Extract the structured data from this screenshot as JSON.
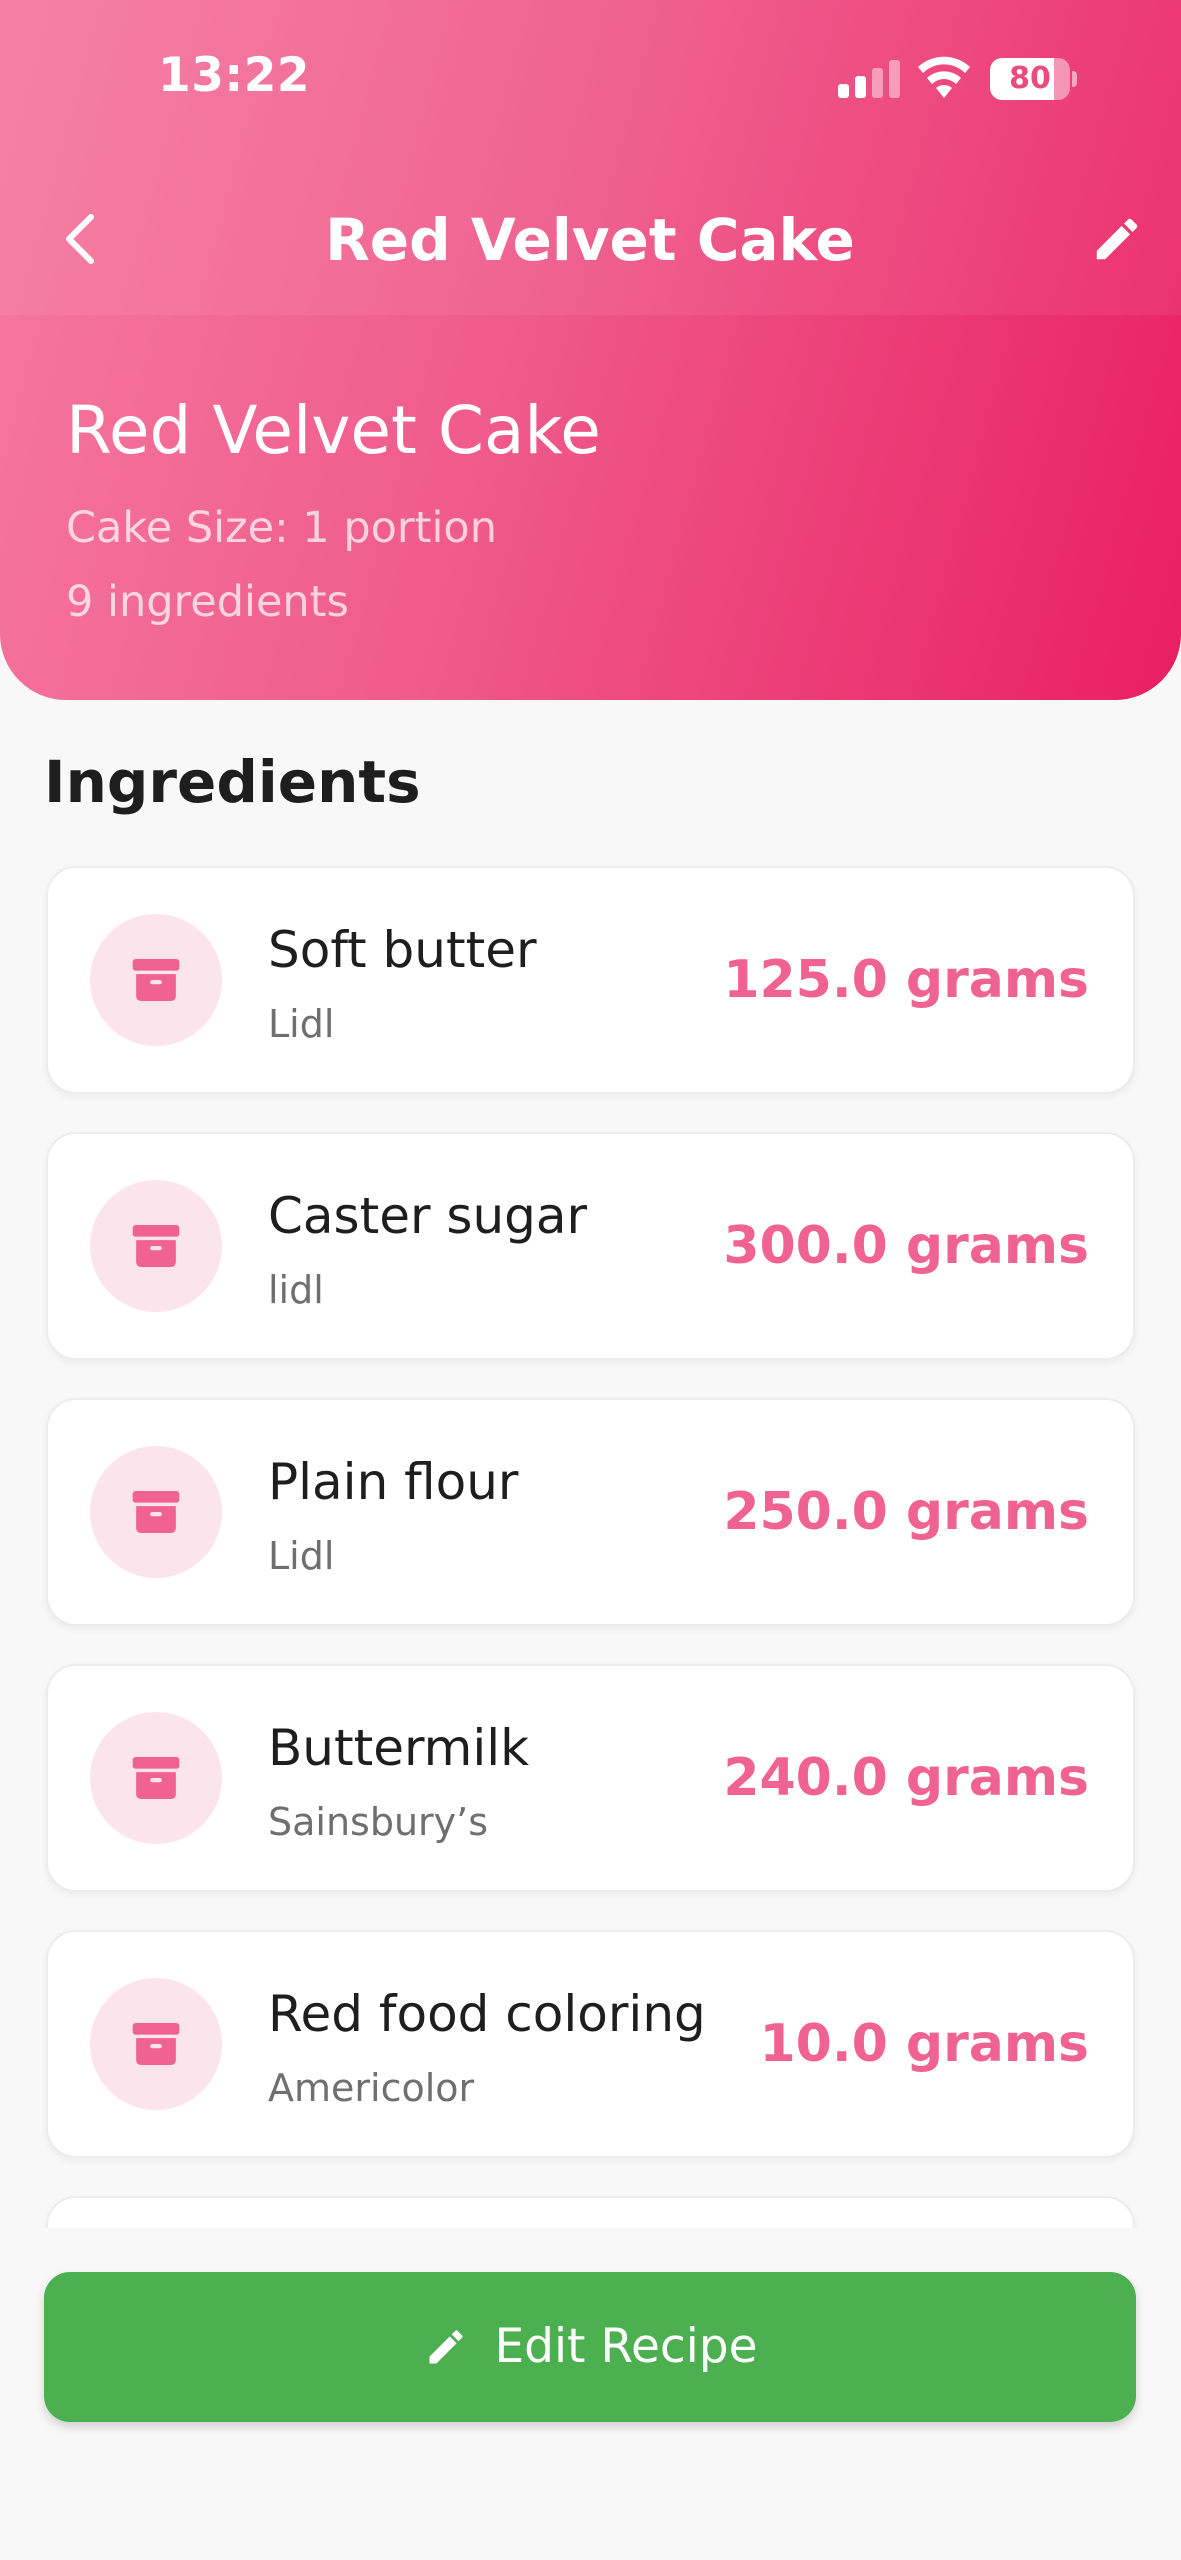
{
  "status_bar": {
    "time": "13:22",
    "battery_level": "80",
    "battery_fraction": 0.8,
    "icons": [
      "signal-icon",
      "wifi-icon",
      "battery-icon"
    ]
  },
  "app_bar": {
    "title": "Red Velvet Cake",
    "back_icon": "chevron-left-icon",
    "edit_icon": "pencil-icon"
  },
  "recipe": {
    "name": "Red Velvet Cake",
    "size": "Cake Size: 1 portion",
    "ingredient_count": "9 ingredients"
  },
  "ingredients_section": {
    "title": "Ingredients",
    "item_icon": "archive-box-icon",
    "items": [
      {
        "name": "Soft butter",
        "store": "Lidl",
        "quantity": "125.0 grams"
      },
      {
        "name": "Caster sugar",
        "store": "lidl",
        "quantity": "300.0 grams"
      },
      {
        "name": "Plain flour",
        "store": "Lidl",
        "quantity": "250.0 grams"
      },
      {
        "name": "Buttermilk",
        "store": "Sainsbury’s",
        "quantity": "240.0 grams"
      },
      {
        "name": "Red food coloring",
        "store": "Americolor",
        "quantity": "10.0 grams"
      }
    ]
  },
  "actions": {
    "edit_recipe_label": "Edit Recipe",
    "edit_recipe_icon": "pencil-icon"
  },
  "colors": {
    "header_gradient_start": "#f67aa0",
    "header_gradient_end": "#e91e63",
    "accent_pink": "#f06292",
    "icon_circle_bg": "#fce4ec",
    "primary_button": "#4caf50",
    "background": "#f8f8f8"
  }
}
